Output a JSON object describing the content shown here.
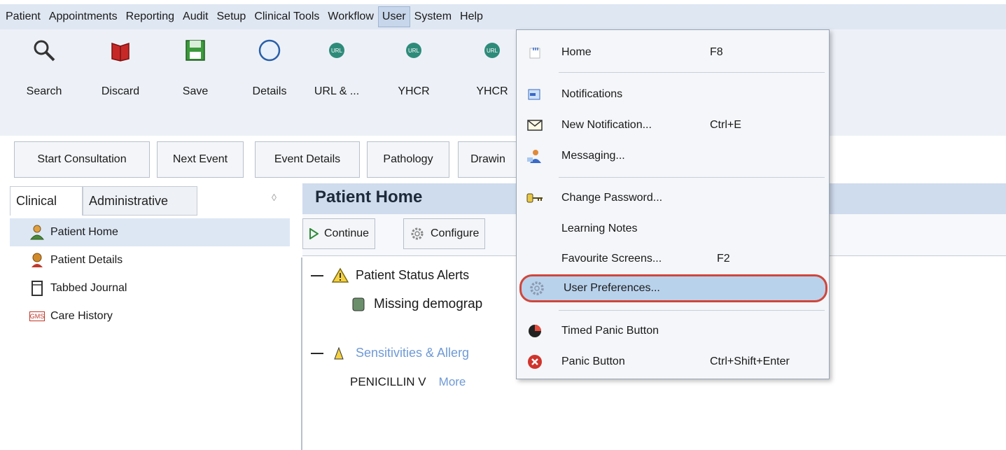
{
  "menubar": {
    "items": [
      "Patient",
      "Appointments",
      "Reporting",
      "Audit",
      "Setup",
      "Clinical Tools",
      "Workflow",
      "User",
      "System",
      "Help"
    ],
    "active": "User"
  },
  "toolbar": {
    "buttons": [
      {
        "label": "Search",
        "icon": "magnifier-icon"
      },
      {
        "label": "Discard",
        "icon": "red-book-icon"
      },
      {
        "label": "Save",
        "icon": "floppy-disk-icon"
      },
      {
        "label": "Details",
        "icon": "circle-icon"
      },
      {
        "label": "URL & ...",
        "icon": "url-globe-icon"
      },
      {
        "label": "YHCR",
        "icon": "url-globe-icon"
      },
      {
        "label": "YHCR",
        "icon": "url-globe-icon"
      }
    ],
    "actions": [
      "Start Consultation",
      "Next Event",
      "Event Details",
      "Pathology",
      "Drawin"
    ]
  },
  "left": {
    "tabs": [
      "Clinical",
      "Administrative"
    ],
    "items": [
      {
        "label": "Patient Home",
        "icon": "patient-home-icon",
        "selected": true
      },
      {
        "label": "Patient Details",
        "icon": "patient-details-icon",
        "selected": false
      },
      {
        "label": "Tabbed Journal",
        "icon": "journal-icon",
        "selected": false
      },
      {
        "label": "Care History",
        "icon": "gms-icon",
        "selected": false
      }
    ],
    "gms_badge": "GMS"
  },
  "main": {
    "title": "Patient Home",
    "buttons": [
      "Continue",
      "Configure"
    ],
    "alerts_title": "Patient Status Alerts",
    "alert_item": "Missing demograp",
    "sensitivities_title": "Sensitivities & Allerg",
    "allergy": "PENICILLIN V",
    "more_link": "More",
    "collapse": "—"
  },
  "user_menu": {
    "items": [
      {
        "label": "Home",
        "key": "F8",
        "icon": "home-icon"
      },
      {
        "label": "Notifications",
        "key": "",
        "icon": "notifications-icon"
      },
      {
        "label": "New Notification...",
        "key": "Ctrl+E",
        "icon": "envelope-icon"
      },
      {
        "label": "Messaging...",
        "key": "",
        "icon": "messaging-icon"
      },
      {
        "label": "Change Password...",
        "key": "",
        "icon": "key-icon"
      },
      {
        "label": "Learning Notes",
        "key": "",
        "icon": ""
      },
      {
        "label": "Favourite Screens...",
        "key": "F2",
        "icon": ""
      },
      {
        "label": "User Preferences...",
        "key": "",
        "icon": "gear-icon",
        "highlighted": true
      },
      {
        "label": "Timed Panic Button",
        "key": "",
        "icon": "timer-icon"
      },
      {
        "label": "Panic Button",
        "key": "Ctrl+Shift+Enter",
        "icon": "panic-icon"
      }
    ]
  },
  "colors": {
    "menubar_bg": "#dfe7f2",
    "toolbar_bg": "#edf1f7",
    "header_bg": "#cfdcee",
    "highlight_ring": "#d0463b",
    "highlight_fill": "#b9d2ec",
    "link": "#6f9ad6"
  }
}
